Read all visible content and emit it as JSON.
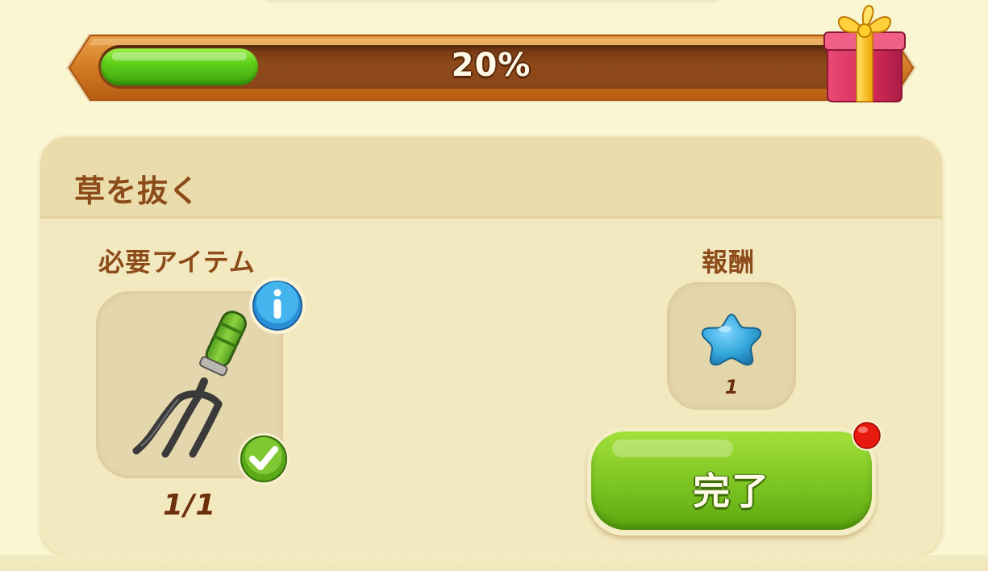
{
  "progress": {
    "percent_label": "20%",
    "fraction": 0.2,
    "reward_icon": "gift-box-icon"
  },
  "task": {
    "title": "草を抜く",
    "required_label": "必要アイテム",
    "required_item": {
      "icon": "garden-fork-icon",
      "count": "1/1",
      "info_icon": "info-icon",
      "status_icon": "checkmark-icon"
    },
    "reward_label": "報酬",
    "reward": {
      "icon": "blue-star-icon",
      "amount": "1"
    },
    "complete_button": "完了",
    "notification_icon": "red-dot-icon"
  },
  "colors": {
    "progress_fill": "#5fcf19",
    "progress_track": "#8a4519",
    "title_text": "#8c4b19",
    "button_green": "#7cc422",
    "star_blue": "#35a9dc",
    "notify_red": "#e8190e"
  }
}
